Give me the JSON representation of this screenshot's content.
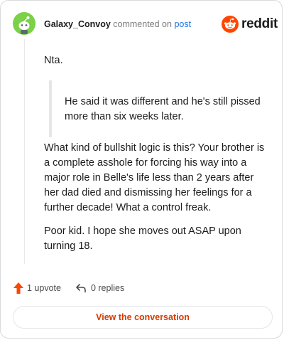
{
  "comment": {
    "username": "Galaxy_Convoy",
    "commented_text": "commented on",
    "post_link_text": "post",
    "brand": {
      "wordmark": "reddit",
      "icon": "reddit-snoo-icon",
      "color": "#ff4500"
    },
    "avatar": {
      "icon": "snoo-avatar-icon",
      "color": "#7bd148"
    },
    "body_first": "Nta.",
    "quote": "He said it was different and he's still pissed more than six weeks later.",
    "paragraphs": [
      "What kind of bullshit logic is this? Your brother is a complete asshole for forcing his way into a major role in Belle's life less than 2 years after her dad died and dismissing her feelings for a further decade! What a control freak.",
      "Poor kid. I hope she moves out ASAP upon turning 18."
    ]
  },
  "actions": {
    "upvote_label": "1 upvote",
    "upvote_icon": "upvote-arrow-icon",
    "upvote_color": "#ff4500",
    "replies_label": "0 replies",
    "replies_icon": "reply-arrow-icon"
  },
  "footer": {
    "view_conversation_label": "View the conversation",
    "accent_color": "#d93a00"
  }
}
